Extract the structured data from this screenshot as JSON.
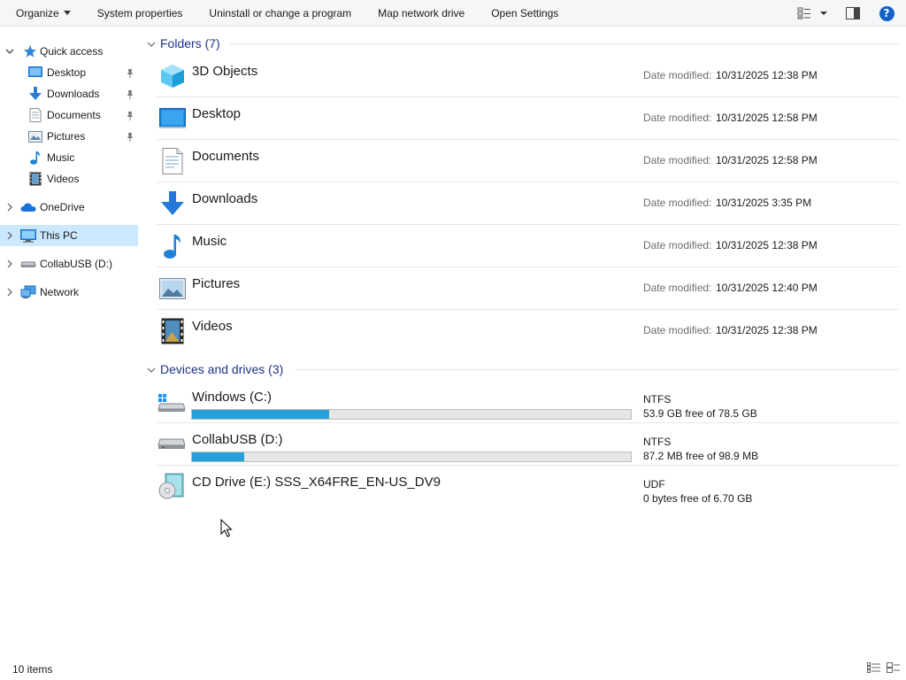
{
  "toolbar": {
    "organize": "Organize",
    "system_properties": "System properties",
    "uninstall": "Uninstall or change a program",
    "map_drive": "Map network drive",
    "open_settings": "Open Settings",
    "help": "?"
  },
  "nav": {
    "quick_access": "Quick access",
    "qa_items": [
      {
        "label": "Desktop",
        "icon": "desktop-icon",
        "pinned": true
      },
      {
        "label": "Downloads",
        "icon": "downloads-icon",
        "pinned": true
      },
      {
        "label": "Documents",
        "icon": "documents-icon",
        "pinned": true
      },
      {
        "label": "Pictures",
        "icon": "pictures-icon",
        "pinned": true
      },
      {
        "label": "Music",
        "icon": "music-icon",
        "pinned": false
      },
      {
        "label": "Videos",
        "icon": "videos-icon",
        "pinned": false
      }
    ],
    "onedrive": "OneDrive",
    "this_pc": "This PC",
    "collabusb": "CollabUSB (D:)",
    "network": "Network"
  },
  "groups": {
    "folders": "Folders (7)",
    "devices": "Devices and drives (3)"
  },
  "folders": [
    {
      "name": "3D Objects",
      "date_label": "Date modified:",
      "date": "10/31/2025 12:38 PM"
    },
    {
      "name": "Desktop",
      "date_label": "Date modified:",
      "date": "10/31/2025 12:58 PM"
    },
    {
      "name": "Documents",
      "date_label": "Date modified:",
      "date": "10/31/2025 12:58 PM"
    },
    {
      "name": "Downloads",
      "date_label": "Date modified:",
      "date": "10/31/2025 3:35 PM"
    },
    {
      "name": "Music",
      "date_label": "Date modified:",
      "date": "10/31/2025 12:38 PM"
    },
    {
      "name": "Pictures",
      "date_label": "Date modified:",
      "date": "10/31/2025 12:40 PM"
    },
    {
      "name": "Videos",
      "date_label": "Date modified:",
      "date": "10/31/2025 12:38 PM"
    }
  ],
  "drives": [
    {
      "name": "Windows (C:)",
      "fs": "NTFS",
      "free": "53.9 GB free of 78.5 GB",
      "used_fraction": 0.313
    },
    {
      "name": "CollabUSB (D:)",
      "fs": "NTFS",
      "free": "87.2 MB free of 98.9 MB",
      "used_fraction": 0.118
    },
    {
      "name": "CD Drive (E:) SSS_X64FRE_EN-US_DV9",
      "fs": "UDF",
      "free": "0 bytes free of 6.70 GB"
    }
  ],
  "status": {
    "items": "10 items"
  },
  "colors": {
    "accent": "#26a0da",
    "selected": "#cce8ff",
    "group_header": "#1e3287"
  }
}
